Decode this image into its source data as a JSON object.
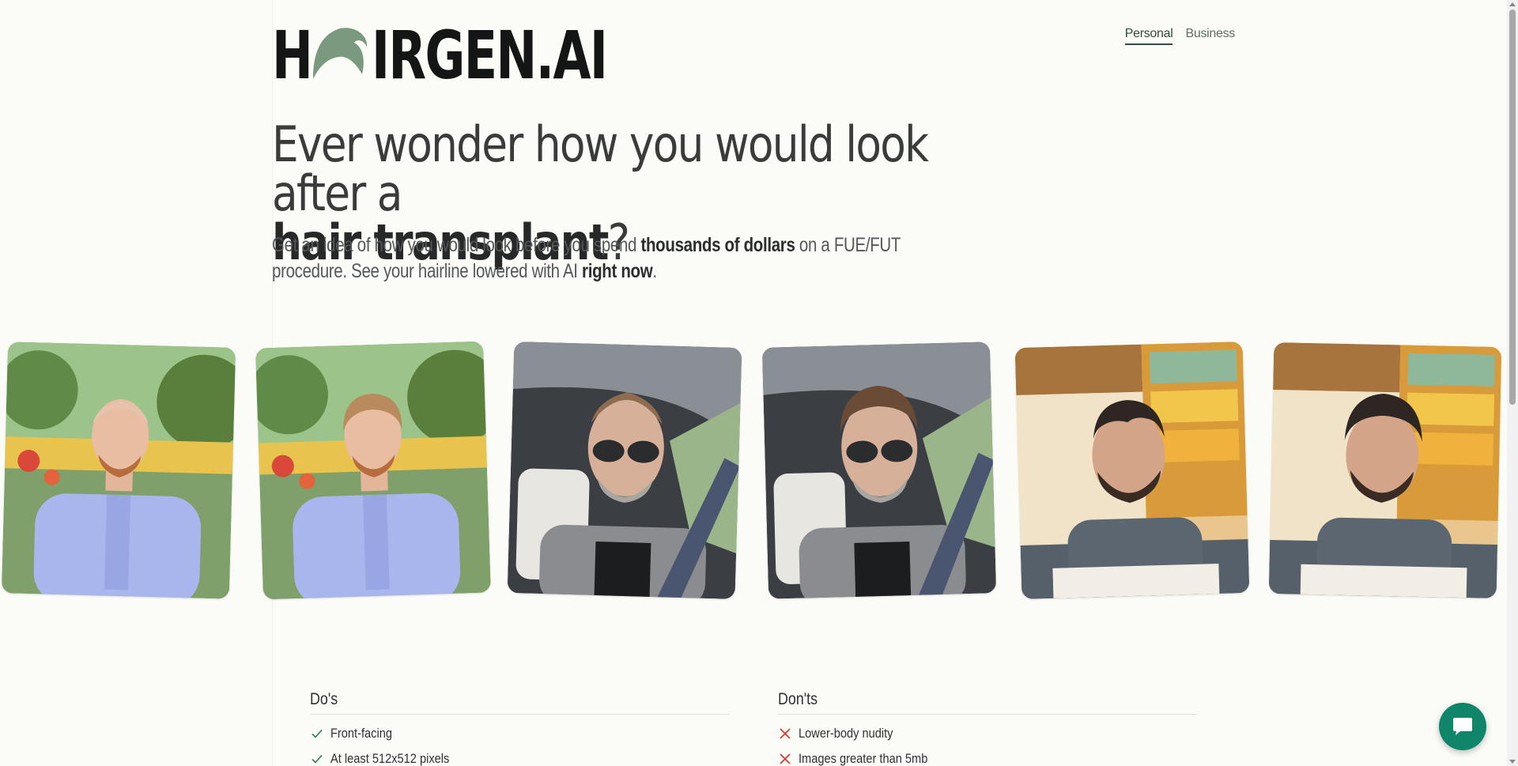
{
  "brand": {
    "logo_h": "H",
    "logo_rest": "IRGEN.AI",
    "hair_color": "#7a9a80"
  },
  "nav": {
    "items": [
      {
        "label": "Personal",
        "active": true
      },
      {
        "label": "Business",
        "active": false
      }
    ]
  },
  "hero": {
    "title_line1": "Ever wonder how you would look after a",
    "title_strong": "hair transplant",
    "title_end": "?",
    "subtitle_part1": "Get an idea of how you would look before you spend ",
    "subtitle_bold1": "thousands of dollars",
    "subtitle_part2": " on a FUE/FUT procedure. See your hairline lowered with AI ",
    "subtitle_bold2": "right now",
    "subtitle_part3": "."
  },
  "gallery": {
    "photos": [
      {
        "name": "photo-man-blue-shirt-before",
        "kind": "outdoor"
      },
      {
        "name": "photo-man-blue-shirt-after",
        "kind": "outdoor"
      },
      {
        "name": "photo-man-sunglasses-car-before",
        "kind": "car"
      },
      {
        "name": "photo-man-sunglasses-car-after",
        "kind": "car"
      },
      {
        "name": "photo-man-restaurant-before",
        "kind": "cafe"
      },
      {
        "name": "photo-man-restaurant-after",
        "kind": "cafe"
      }
    ]
  },
  "dos": {
    "heading": "Do's",
    "items": [
      "Front-facing",
      "At least 512x512 pixels"
    ],
    "icon": "check-icon",
    "icon_color": "#2e7d4f"
  },
  "donts": {
    "heading": "Don'ts",
    "items": [
      "Lower-body nudity",
      "Images greater than 5mb"
    ],
    "icon": "cross-icon",
    "icon_color": "#d9342b"
  },
  "chat": {
    "icon": "chat-bubble-icon",
    "color": "#0f8569"
  }
}
